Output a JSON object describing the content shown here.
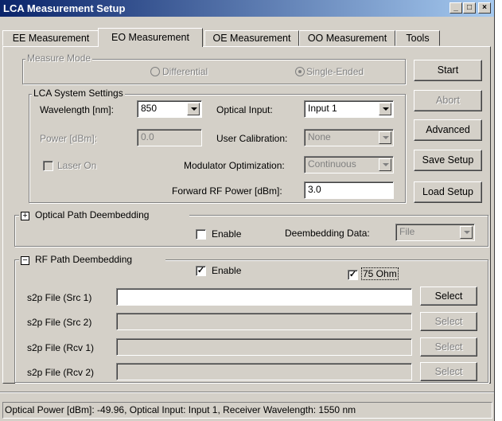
{
  "window": {
    "title": "LCA Measurement Setup"
  },
  "tabs": [
    {
      "label": "EE Measurement"
    },
    {
      "label": "EO Measurement"
    },
    {
      "label": "OE Measurement"
    },
    {
      "label": "OO Measurement"
    },
    {
      "label": "Tools"
    }
  ],
  "measure_mode": {
    "label": "Measure Mode",
    "differential": "Differential",
    "single_ended": "Single-Ended",
    "selected": "Single-Ended"
  },
  "system": {
    "label": "LCA System Settings",
    "wavelength_label": "Wavelength [nm]:",
    "wavelength_value": "850",
    "optical_input_label": "Optical Input:",
    "optical_input_value": "Input 1",
    "power_label": "Power [dBm]:",
    "power_value": "0.0",
    "user_cal_label": "User Calibration:",
    "user_cal_value": "None",
    "laser_on_label": "Laser On",
    "mod_opt_label": "Modulator Optimization:",
    "mod_opt_value": "Continuous",
    "rf_power_label": "Forward RF Power [dBm]:",
    "rf_power_value": "3.0"
  },
  "buttons": {
    "start": "Start",
    "abort": "Abort",
    "advanced": "Advanced",
    "save_setup": "Save Setup",
    "load_setup": "Load Setup"
  },
  "optical_path": {
    "label": "Optical Path Deembedding",
    "expander": "+",
    "enable_label": "Enable",
    "enable_checked": false,
    "data_label": "Deembedding Data:",
    "data_value": "File"
  },
  "rf_path": {
    "label": "RF Path Deembedding",
    "expander": "−",
    "enable_label": "Enable",
    "enable_checked": true,
    "ohm_label": "75 Ohm",
    "ohm_checked": true,
    "rows": [
      {
        "label": "s2p File (Src 1)",
        "value": "",
        "button": "Select",
        "enabled": true
      },
      {
        "label": "s2p File (Src 2)",
        "value": "",
        "button": "Select",
        "enabled": false
      },
      {
        "label": "s2p File (Rcv 1)",
        "value": "",
        "button": "Select",
        "enabled": false
      },
      {
        "label": "s2p File (Rcv 2)",
        "value": "",
        "button": "Select",
        "enabled": false
      }
    ]
  },
  "status": "Optical Power [dBm]: -49.96,  Optical Input: Input 1, Receiver Wavelength: 1550 nm"
}
